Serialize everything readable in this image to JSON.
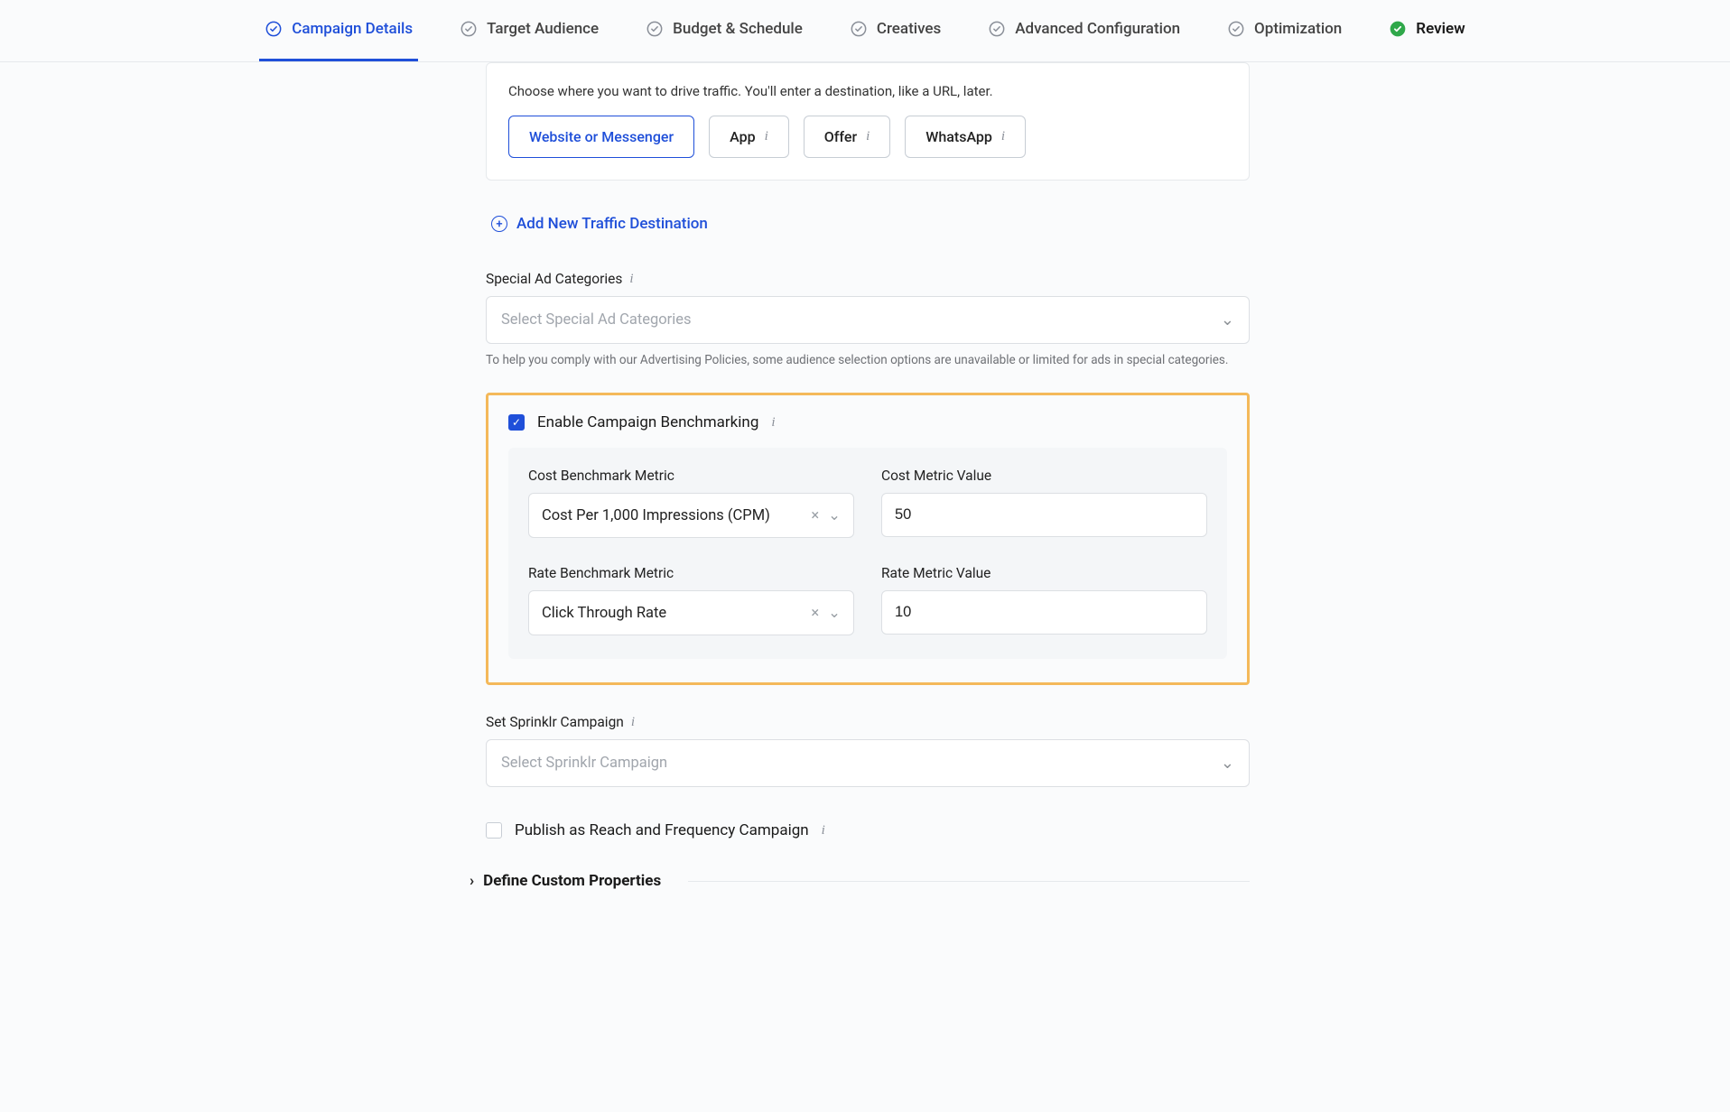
{
  "tabs": [
    {
      "label": "Campaign Details",
      "state": "active"
    },
    {
      "label": "Target Audience",
      "state": "normal"
    },
    {
      "label": "Budget & Schedule",
      "state": "normal"
    },
    {
      "label": "Creatives",
      "state": "normal"
    },
    {
      "label": "Advanced Configuration",
      "state": "normal"
    },
    {
      "label": "Optimization",
      "state": "normal"
    },
    {
      "label": "Review",
      "state": "done"
    }
  ],
  "traffic": {
    "description": "Choose where you want to drive traffic. You'll enter a destination, like a URL, later.",
    "options": [
      {
        "label": "Website or Messenger",
        "selected": true,
        "info": false
      },
      {
        "label": "App",
        "selected": false,
        "info": true
      },
      {
        "label": "Offer",
        "selected": false,
        "info": true
      },
      {
        "label": "WhatsApp",
        "selected": false,
        "info": true
      }
    ],
    "add_link": "Add New Traffic Destination"
  },
  "special_categories": {
    "label": "Special Ad Categories",
    "placeholder": "Select Special Ad Categories",
    "help": "To help you comply with our Advertising Policies, some audience selection options are unavailable or limited for ads in special categories."
  },
  "benchmarking": {
    "enable_label": "Enable Campaign Benchmarking",
    "enabled": true,
    "cost_metric_label": "Cost Benchmark Metric",
    "cost_metric_value": "Cost Per 1,000 Impressions (CPM)",
    "cost_value_label": "Cost Metric Value",
    "cost_value": "50",
    "rate_metric_label": "Rate Benchmark Metric",
    "rate_metric_value": "Click Through Rate",
    "rate_value_label": "Rate Metric Value",
    "rate_value": "10"
  },
  "sprinklr_campaign": {
    "label": "Set Sprinklr Campaign",
    "placeholder": "Select Sprinklr Campaign"
  },
  "publish_reach": {
    "label": "Publish as Reach and Frequency Campaign",
    "checked": false
  },
  "define_custom": {
    "label": "Define Custom Properties"
  }
}
